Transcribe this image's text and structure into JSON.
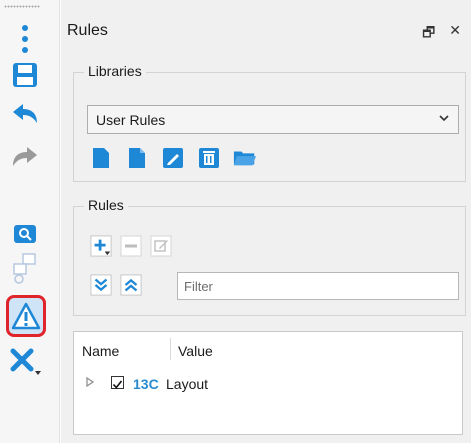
{
  "colors": {
    "accent": "#1e88d6",
    "selection_outline": "#e0242b",
    "rule_id": "#2a8bcf"
  },
  "toolbar": {
    "items": [
      {
        "name": "more-vertical-icon"
      },
      {
        "name": "save-icon"
      },
      {
        "name": "undo-icon"
      },
      {
        "name": "redo-icon"
      },
      {
        "name": "search-screen-icon"
      },
      {
        "name": "hierarchy-icon"
      },
      {
        "name": "warning-icon",
        "selected": true
      },
      {
        "name": "tools-icon"
      }
    ]
  },
  "panel": {
    "title": "Rules",
    "float_icon": "🗗",
    "close_icon": "✕",
    "libraries": {
      "label": "Libraries",
      "selected": "User Rules",
      "buttons": [
        "new-library-icon",
        "new-file-icon",
        "edit-icon",
        "delete-icon",
        "open-folder-icon"
      ]
    },
    "rules": {
      "label": "Rules",
      "buttons": [
        "add-rule-icon",
        "remove-rule-icon",
        "edit-rule-icon"
      ],
      "nav_buttons": [
        "move-down-icon",
        "move-up-icon"
      ],
      "filter_placeholder": "Filter"
    },
    "table": {
      "columns": [
        "Name",
        "Value"
      ],
      "rows": [
        {
          "checked": true,
          "id": "13C",
          "value": "Layout"
        }
      ]
    }
  }
}
